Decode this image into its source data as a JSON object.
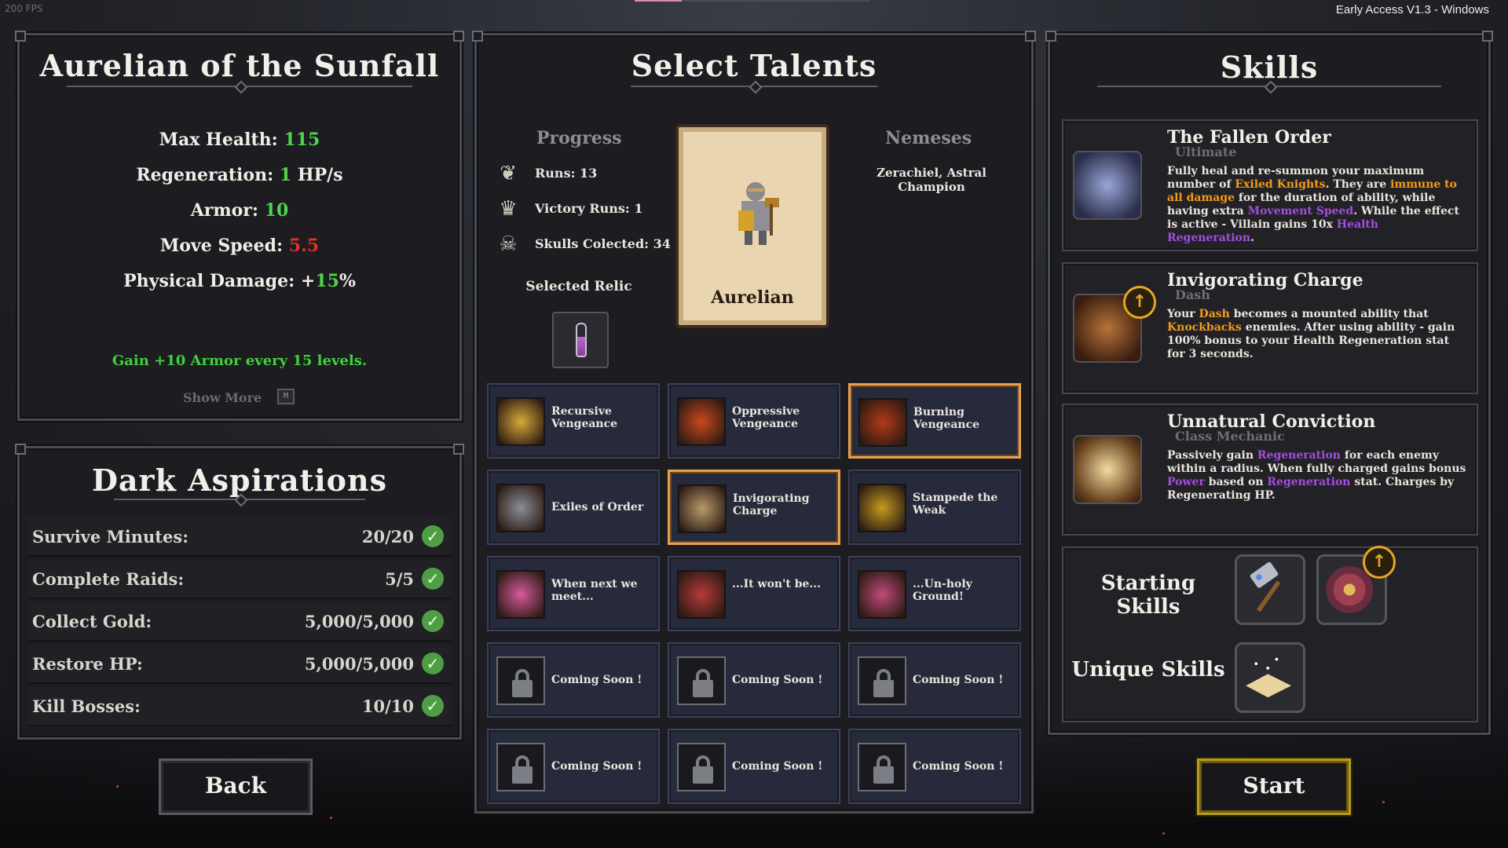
{
  "fps": "200 FPS",
  "version": "Early Access V1.3 - Windows",
  "hero": {
    "title": "Aurelian of the Sunfall",
    "stats": {
      "max_health_label": "Max Health: ",
      "max_health_value": "115",
      "regen_label": "Regeneration: ",
      "regen_value": "1",
      "regen_unit": " HP/s",
      "armor_label": "Armor: ",
      "armor_value": "10",
      "speed_label": "Move Speed: ",
      "speed_value": "5.5",
      "phys_label": "Physical Damage: +",
      "phys_value": "15",
      "phys_unit": "%"
    },
    "perk": "Gain +10 Armor every 15 levels.",
    "show_more": "Show More",
    "show_more_key": "M"
  },
  "aspirations": {
    "title": "Dark Aspirations",
    "rows": [
      {
        "label": "Survive Minutes:",
        "value": "20/20"
      },
      {
        "label": "Complete Raids:",
        "value": "5/5"
      },
      {
        "label": "Collect Gold:",
        "value": "5,000/5,000"
      },
      {
        "label": "Restore HP:",
        "value": "5,000/5,000"
      },
      {
        "label": "Kill Bosses:",
        "value": "10/10"
      }
    ]
  },
  "buttons": {
    "back": "Back",
    "start": "Start"
  },
  "talents_panel": {
    "title": "Select Talents",
    "progress_label": "Progress",
    "nemeses_label": "Nemeses",
    "progress": [
      {
        "icon": "feather-icon",
        "text": "Runs: 13"
      },
      {
        "icon": "crown-icon",
        "text": "Victory Runs: 1"
      },
      {
        "icon": "skull-icon",
        "text": "Skulls Colected: 34"
      }
    ],
    "relic_label": "Selected Relic",
    "character_name": "Aurelian",
    "nemesis": "Zerachiel, Astral Champion",
    "talents": [
      {
        "name": "Recursive Vengeance",
        "color": "#d8a93a",
        "selected": false
      },
      {
        "name": "Oppressive Vengeance",
        "color": "#c9481e",
        "selected": false
      },
      {
        "name": "Burning Vengeance",
        "color": "#b33a17",
        "selected": true
      },
      {
        "name": "Exiles of Order",
        "color": "#8b8d96",
        "selected": false
      },
      {
        "name": "Invigorating Charge",
        "color": "#b89a6a",
        "selected": true
      },
      {
        "name": "Stampede the Weak",
        "color": "#c49a1f",
        "selected": false
      },
      {
        "name": "When next we meet...",
        "color": "#d65a9c",
        "selected": false
      },
      {
        "name": "...It won't be...",
        "color": "#b73a3a",
        "selected": false
      },
      {
        "name": "...Un-holy Ground!",
        "color": "#c04a7a",
        "selected": false
      },
      {
        "name": "Coming Soon !",
        "locked": true
      },
      {
        "name": "Coming Soon !",
        "locked": true
      },
      {
        "name": "Coming Soon !",
        "locked": true
      },
      {
        "name": "Coming Soon !",
        "locked": true
      },
      {
        "name": "Coming Soon !",
        "locked": true
      },
      {
        "name": "Coming Soon !",
        "locked": true
      }
    ]
  },
  "skills_panel": {
    "title": "Skills",
    "skills": [
      {
        "name": "The Fallen Order",
        "type": "Ultimate",
        "desc": [
          {
            "t": "Fully heal and re-summon your maximum number of ",
            "c": ""
          },
          {
            "t": "Exiled Knights",
            "c": "o"
          },
          {
            "t": ". They are ",
            "c": ""
          },
          {
            "t": "immune to all damage",
            "c": "o"
          },
          {
            "t": " for the duration of ability, while having extra ",
            "c": ""
          },
          {
            "t": "Movement Speed",
            "c": "p"
          },
          {
            "t": ". While the effect is active - Villain gains 10x ",
            "c": ""
          },
          {
            "t": "Health Regeneration",
            "c": "p"
          },
          {
            "t": ".",
            "c": ""
          }
        ]
      },
      {
        "name": "Invigorating Charge",
        "type": "Dash",
        "desc": [
          {
            "t": "Your ",
            "c": ""
          },
          {
            "t": "Dash",
            "c": "o"
          },
          {
            "t": " becomes a mounted ability that ",
            "c": ""
          },
          {
            "t": "Knockbacks",
            "c": "o"
          },
          {
            "t": " enemies. After using ability - gain 100% bonus to your Health Regeneration stat for 3 seconds.",
            "c": ""
          }
        ]
      },
      {
        "name": "Unnatural Conviction",
        "type": "Class Mechanic",
        "desc": [
          {
            "t": "Passively gain ",
            "c": ""
          },
          {
            "t": "Regeneration",
            "c": "p"
          },
          {
            "t": " for each enemy within a radius. When fully charged gains bonus ",
            "c": ""
          },
          {
            "t": "Power",
            "c": "p"
          },
          {
            "t": " based on ",
            "c": ""
          },
          {
            "t": "Regeneration",
            "c": "p"
          },
          {
            "t": " stat. Charges by Regenerating HP.",
            "c": ""
          }
        ]
      }
    ],
    "starting_label": "Starting Skills",
    "unique_label": "Unique Skills",
    "badge_glyph": "↑"
  }
}
